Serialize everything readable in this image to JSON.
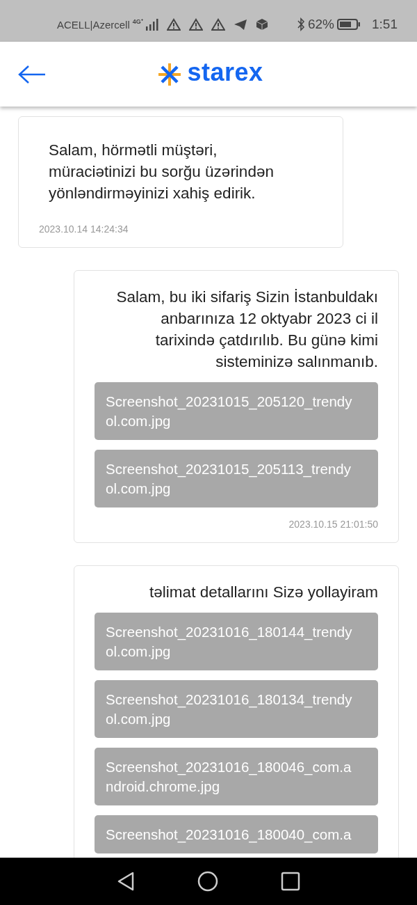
{
  "status_bar": {
    "carrier": "ACELL|Azercell",
    "network": "4G⁺",
    "battery_percent": "62%",
    "time": "1:51"
  },
  "header": {
    "logo_text": "starex"
  },
  "messages": [
    {
      "kind": "incoming",
      "text": "Salam, hörmətli müştəri, müraciətinizi bu sorğu üzərindən yönləndirməyinizi xahiş edirik.",
      "time": "2023.10.14 14:24:34"
    },
    {
      "kind": "outgoing",
      "text": "Salam, bu iki sifariş Sizin İstanbuldakı anbarınıza 12 oktyabr 2023 ci il tarixində çatdırılıb. Bu günə kimi sisteminizə salınmanıb.",
      "attachments": [
        "Screenshot_20231015_205120_trendyol.com.jpg",
        "Screenshot_20231015_205113_trendyol.com.jpg"
      ],
      "time": "2023.10.15 21:01:50"
    },
    {
      "kind": "outgoing",
      "text": "təlimat detallarını Sizə yollayiram",
      "attachments": [
        "Screenshot_20231016_180144_trendyol.com.jpg",
        "Screenshot_20231016_180134_trendyol.com.jpg",
        "Screenshot_20231016_180046_com.android.chrome.jpg",
        "Screenshot_20231016_180040_com.a"
      ]
    }
  ]
}
